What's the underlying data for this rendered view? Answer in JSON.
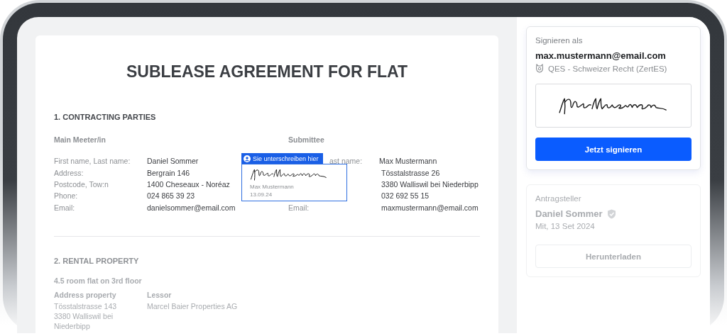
{
  "document": {
    "title": "SUBLEASE AGREEMENT FOR FLAT",
    "sections": [
      {
        "kind": "parties",
        "heading": "1. CONTRACTING PARTIES",
        "parties": [
          {
            "heading": "Main Meeter/in",
            "rows": [
              {
                "label": "First name, Last name:",
                "value": "Daniel Sommer"
              },
              {
                "label": "Address:",
                "value": "Bergrain 146"
              },
              {
                "label": "Postcode, Tow:n",
                "value": "1400 Cheseaux - Noréaz"
              },
              {
                "label": "Phone:",
                "value": "024 865 39 23"
              },
              {
                "label": "Email:",
                "value": "danielsommer@email.com"
              }
            ]
          },
          {
            "heading": "Submittee",
            "rows": [
              {
                "label": "ast name:",
                "value": "Max Mustermann"
              },
              {
                "value": "Tösstalstrasse 26"
              },
              {
                "value": "3380 Walliswil bei Niederbipp"
              },
              {
                "value": "032 692 55 15"
              },
              {
                "label": "Email:",
                "value": "maxmustermann@email.com"
              }
            ]
          }
        ]
      },
      {
        "kind": "property",
        "heading": "2. RENTAL PROPERTY",
        "subheading": "4.5 room flat on 3rd floor",
        "columns": [
          {
            "heading": "Address property",
            "lines": [
              "Tösstalstrasse 143",
              "3380 Walliswil bei",
              "Niederbipp"
            ]
          },
          {
            "heading": "Lessor",
            "lines": [
              "Marcel Baier Properties AG"
            ]
          }
        ]
      }
    ],
    "signature_field": {
      "tag": "Sie unterschreiben hier",
      "name": "Max Mustermann",
      "date": "13.09.24"
    }
  },
  "sign_card": {
    "label": "Signieren als",
    "email": "max.mustermann@email.com",
    "certificate": "QES - Schweizer Recht (ZertES)",
    "button": "Jetzt signieren"
  },
  "applicant_card": {
    "label": "Antragsteller",
    "name": "Daniel Sommer",
    "verified": true,
    "date": "Mit, 13 Set 2024",
    "button": "Herunterladen"
  }
}
